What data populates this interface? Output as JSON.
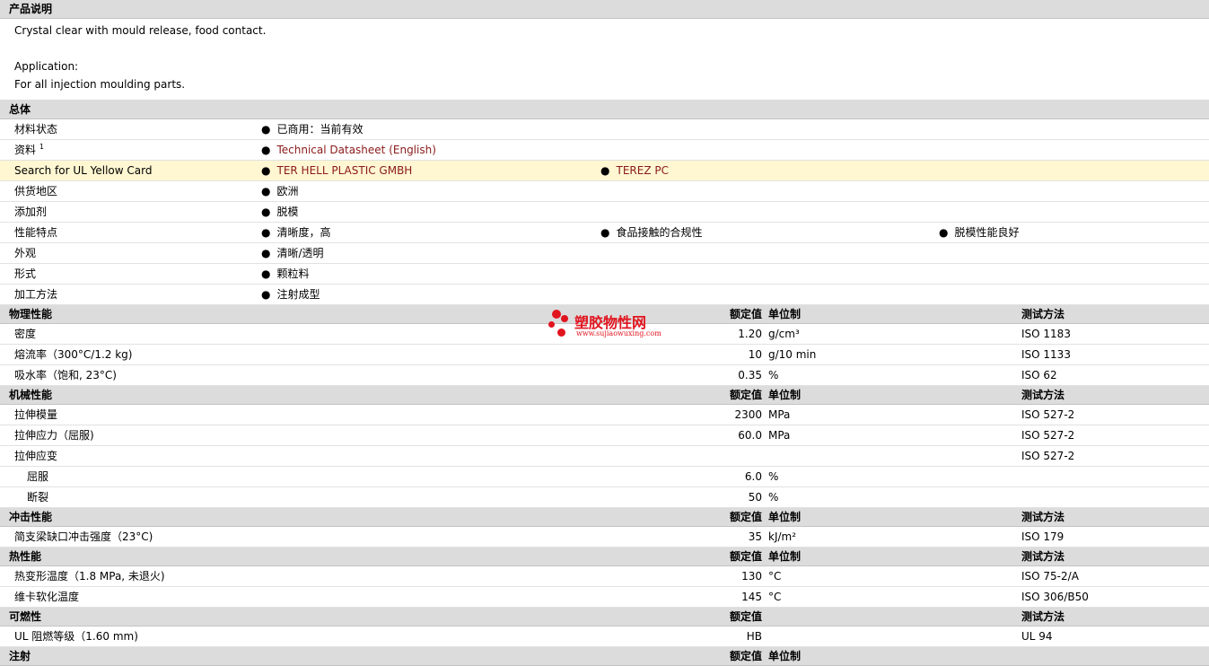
{
  "desc": {
    "header": "产品说明",
    "line1": "Crystal clear with mould release, food contact.",
    "line2": "Application:",
    "line3": "For all injection moulding parts."
  },
  "general": {
    "header": "总体",
    "rows": [
      {
        "label": "材料状态",
        "items": [
          "已商用：当前有效"
        ]
      },
      {
        "label": "资料",
        "sup": "1",
        "items": [
          "Technical Datasheet (English)"
        ]
      },
      {
        "label": "Search for UL Yellow Card",
        "items": [
          "TER HELL PLASTIC GMBH",
          "TEREZ PC"
        ]
      },
      {
        "label": "供货地区",
        "items": [
          "欧洲"
        ]
      },
      {
        "label": "添加剂",
        "items": [
          "脱模"
        ]
      },
      {
        "label": "性能特点",
        "items": [
          "清晰度，高",
          "食品接触的合规性",
          "脱模性能良好"
        ]
      },
      {
        "label": "外观",
        "items": [
          "清晰/透明"
        ]
      },
      {
        "label": "形式",
        "items": [
          "颗粒料"
        ]
      },
      {
        "label": "加工方法",
        "items": [
          "注射成型"
        ]
      }
    ]
  },
  "cols": {
    "value": "额定值",
    "unit": "单位制",
    "method": "测试方法"
  },
  "physical": {
    "header": "物理性能",
    "rows": [
      {
        "label": "密度",
        "value": "1.20",
        "unit": "g/cm³",
        "method": "ISO 1183"
      },
      {
        "label": "熔流率（300°C/1.2 kg)",
        "value": "10",
        "unit": "g/10 min",
        "method": "ISO 1133"
      },
      {
        "label": "吸水率（饱和, 23°C)",
        "value": "0.35",
        "unit": "%",
        "method": "ISO 62"
      }
    ]
  },
  "mechanical": {
    "header": "机械性能",
    "rows": [
      {
        "label": "拉伸模量",
        "value": "2300",
        "unit": "MPa",
        "method": "ISO 527-2"
      },
      {
        "label": "拉伸应力（屈服)",
        "value": "60.0",
        "unit": "MPa",
        "method": "ISO 527-2"
      },
      {
        "label": "拉伸应变",
        "value": "",
        "unit": "",
        "method": "ISO 527-2"
      },
      {
        "label": "屈服",
        "value": "6.0",
        "unit": "%",
        "method": ""
      },
      {
        "label": "断裂",
        "value": "50",
        "unit": "%",
        "method": ""
      }
    ]
  },
  "impact": {
    "header": "冲击性能",
    "rows": [
      {
        "label": "简支梁缺口冲击强度（23°C)",
        "value": "35",
        "unit": "kJ/m²",
        "method": "ISO 179"
      }
    ]
  },
  "thermal": {
    "header": "热性能",
    "rows": [
      {
        "label": "热变形温度（1.8 MPa, 未退火)",
        "value": "130",
        "unit": "°C",
        "method": "ISO 75-2/A"
      },
      {
        "label": "维卡软化温度",
        "value": "145",
        "unit": "°C",
        "method": "ISO 306/B50"
      }
    ]
  },
  "flammability": {
    "header": "可燃性",
    "rows": [
      {
        "label": "UL 阻燃等级（1.60 mm)",
        "value": "HB",
        "unit": "",
        "method": "UL 94"
      }
    ]
  },
  "injection": {
    "header": "注射"
  },
  "watermark": {
    "name": "塑胶物性网",
    "url": "www.sujiaowuxing.com"
  },
  "colors": {
    "section_bg": "#dcdcdc",
    "highlight_bg": "#fff7d2",
    "link": "#8b1a1a",
    "watermark": "#e1141e"
  }
}
